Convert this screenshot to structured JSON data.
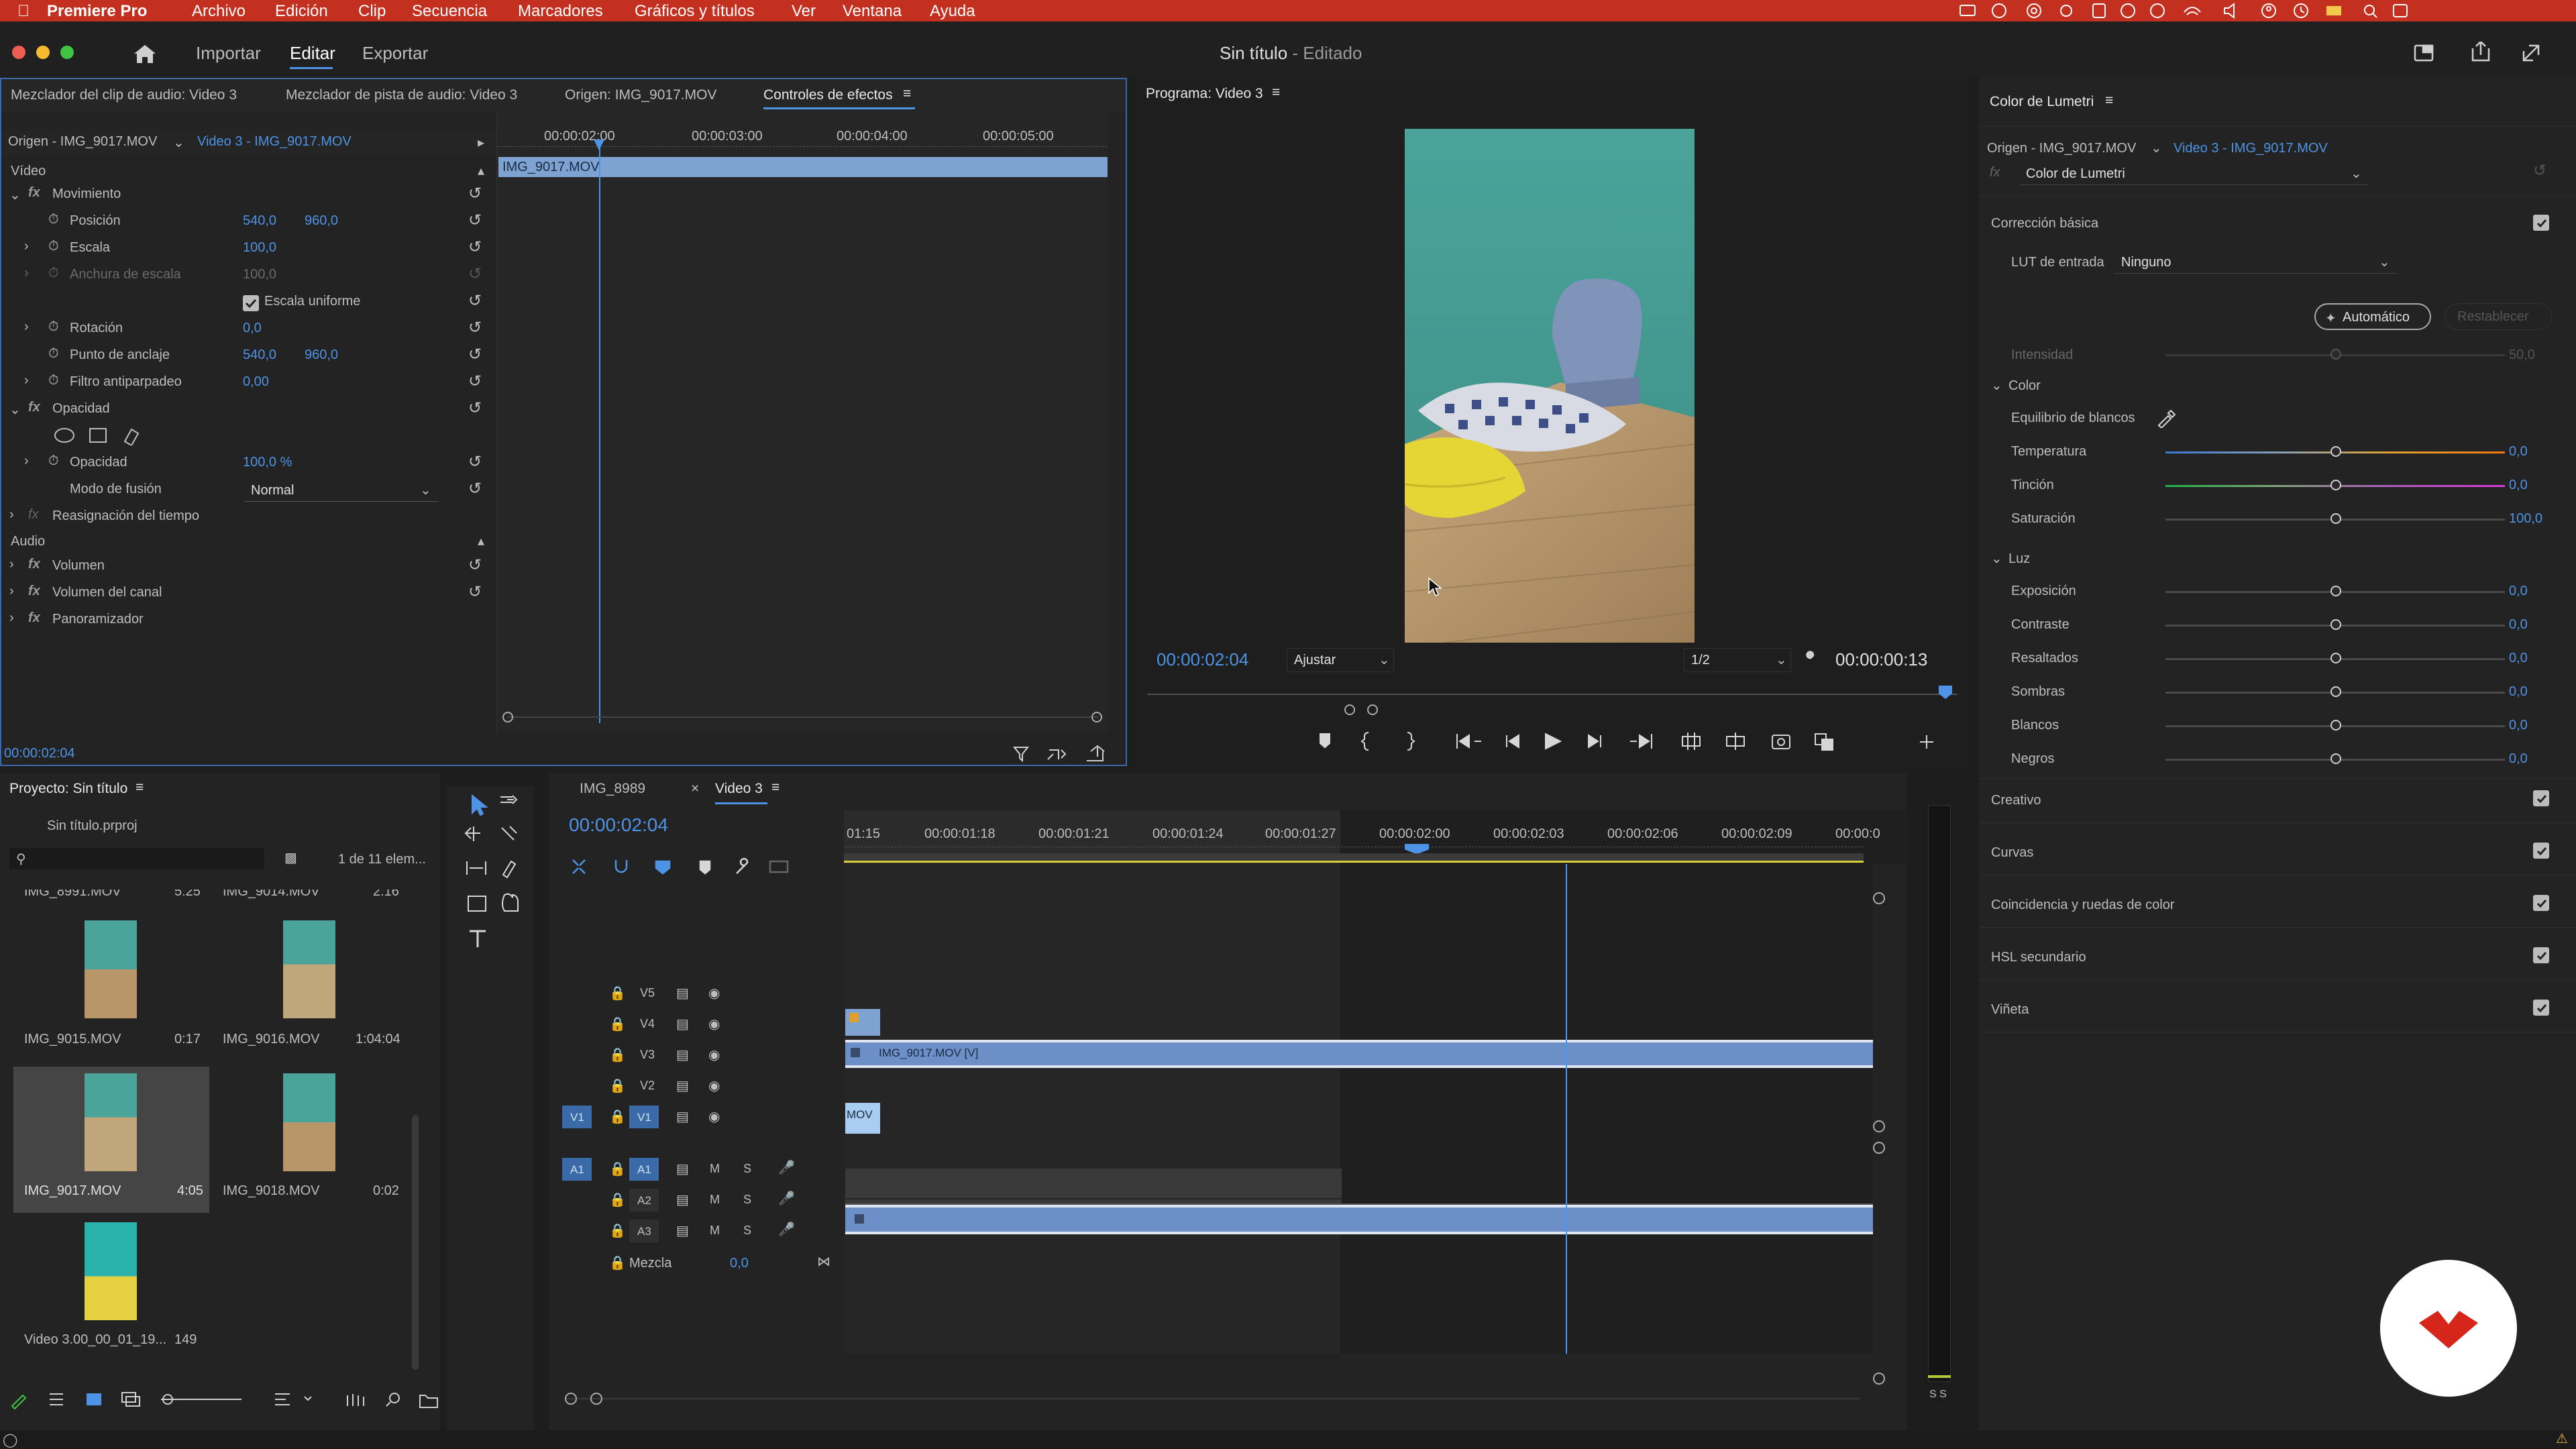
{
  "menubar": {
    "app": "Premiere Pro",
    "items": [
      "Archivo",
      "Edición",
      "Clip",
      "Secuencia",
      "Marcadores",
      "Gráficos y títulos",
      "Ver",
      "Ventana",
      "Ayuda"
    ]
  },
  "header": {
    "nav": [
      "Importar",
      "Editar",
      "Exportar"
    ],
    "doc_title": "Sin título",
    "doc_status": " - Editado"
  },
  "effects_panel": {
    "tabs": [
      "Mezclador del clip de audio: Video 3",
      "Mezclador de pista de audio: Video 3",
      "Origen: IMG_9017.MOV",
      "Controles de efectos"
    ],
    "source_label": "Origen - IMG_9017.MOV",
    "sequence_label": "Video 3 - IMG_9017.MOV",
    "timecodes": [
      "00:00:03:00",
      "00:00:04:00",
      "00:00:05:00"
    ],
    "ruler_start": "00:00:02:00",
    "clip_name": "IMG_9017.MOV",
    "video_header": "Vídeo",
    "audio_header": "Audio",
    "movimiento": "Movimiento",
    "posicion": {
      "label": "Posición",
      "x": "540,0",
      "y": "960,0"
    },
    "escala": {
      "label": "Escala",
      "value": "100,0"
    },
    "anchura": {
      "label": "Anchura de escala",
      "value": "100,0"
    },
    "escala_uniforme": "Escala uniforme",
    "rotacion": {
      "label": "Rotación",
      "value": "0,0"
    },
    "punto_anclaje": {
      "label": "Punto de anclaje",
      "x": "540,0",
      "y": "960,0"
    },
    "filtro": {
      "label": "Filtro antiparpadeo",
      "value": "0,00"
    },
    "opacidad_header": "Opacidad",
    "opacidad": {
      "label": "Opacidad",
      "value": "100,0 %"
    },
    "modo_fusion": {
      "label": "Modo de fusión",
      "value": "Normal"
    },
    "reasignacion": "Reasignación del tiempo",
    "volumen": "Volumen",
    "volumen_canal": "Volumen del canal",
    "panoramizador": "Panoramizador",
    "footer_timecode": "00:00:02:04"
  },
  "program_monitor": {
    "title": "Programa: Video 3",
    "timecode": "00:00:02:04",
    "fit": "Ajustar",
    "resolution": "1/2",
    "duration": "00:00:00:13"
  },
  "lumetri": {
    "title": "Color de Lumetri",
    "source_label": "Origen - IMG_9017.MOV",
    "sequence_label": "Video 3 - IMG_9017.MOV",
    "effect_select": "Color de Lumetri",
    "basic": "Corrección básica",
    "lut_label": "LUT de entrada",
    "lut_value": "Ninguno",
    "auto_btn": "Automático",
    "reset_btn": "Restablecer",
    "intensity": {
      "label": "Intensidad",
      "value": "50,0"
    },
    "color_section": "Color",
    "wb": "Equilibrio de blancos",
    "temperatura": {
      "label": "Temperatura",
      "value": "0,0"
    },
    "tincion": {
      "label": "Tinción",
      "value": "0,0"
    },
    "saturacion": {
      "label": "Saturación",
      "value": "100,0"
    },
    "luz_section": "Luz",
    "exposicion": {
      "label": "Exposición",
      "value": "0,0"
    },
    "contraste": {
      "label": "Contraste",
      "value": "0,0"
    },
    "resaltados": {
      "label": "Resaltados",
      "value": "0,0"
    },
    "sombras": {
      "label": "Sombras",
      "value": "0,0"
    },
    "blancos": {
      "label": "Blancos",
      "value": "0,0"
    },
    "negros": {
      "label": "Negros",
      "value": "0,0"
    },
    "sections": [
      "Creativo",
      "Curvas",
      "Coincidencia y ruedas de color",
      "HSL secundario",
      "Viñeta"
    ]
  },
  "project_panel": {
    "title": "Proyecto: Sin título",
    "file": "Sin título.prproj",
    "count": "1 de 11 elem...",
    "cut_items": [
      {
        "name": "IMG_8991.MOV",
        "dur": "5:25"
      },
      {
        "name": "IMG_9014.MOV",
        "dur": "2:16"
      }
    ],
    "items": [
      {
        "name": "IMG_9015.MOV",
        "dur": "0:17"
      },
      {
        "name": "IMG_9016.MOV",
        "dur": "1:04:04"
      },
      {
        "name": "IMG_9017.MOV",
        "dur": "4:05"
      },
      {
        "name": "IMG_9018.MOV",
        "dur": "0:02"
      },
      {
        "name": "Video 3.00_00_01_19...",
        "dur": "149"
      }
    ]
  },
  "timeline": {
    "tabs": [
      "IMG_8989",
      "Video 3"
    ],
    "timecode": "00:00:02:04",
    "ruler": [
      "01:15",
      "00:00:01:18",
      "00:00:01:21",
      "00:00:01:24",
      "00:00:01:27",
      "00:00:02:00",
      "00:00:02:03",
      "00:00:02:06",
      "00:00:02:09",
      "00:00:0"
    ],
    "video_tracks": [
      "V5",
      "V4",
      "V3",
      "V2",
      "V1"
    ],
    "audio_tracks": [
      "A1",
      "A2",
      "A3"
    ],
    "src_v": "V1",
    "src_a": "A1",
    "m": "M",
    "s": "S",
    "clip_v3": "IMG_9017.MOV [V]",
    "clip_v1": "MOV",
    "mix_label": "Mezcla",
    "mix_value": "0,0",
    "meter_labels": "S S"
  },
  "colors": {
    "accent": "#4d93e6",
    "menubar": "#c4301f",
    "clip": "#5b7fb5"
  }
}
